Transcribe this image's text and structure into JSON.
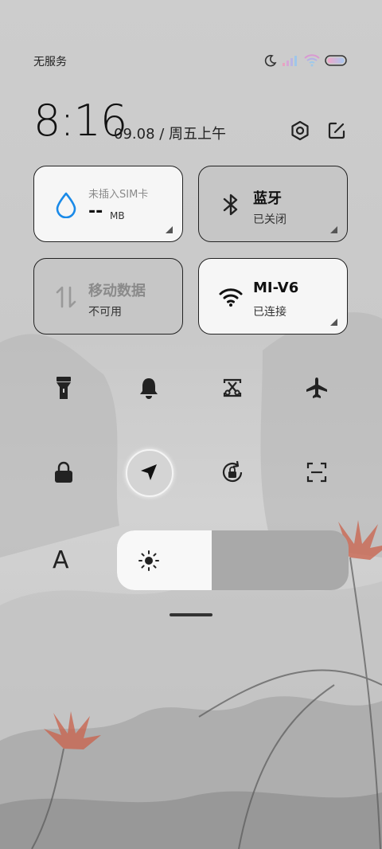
{
  "status_bar": {
    "carrier": "无服务",
    "icons": [
      "moon-icon",
      "signal-icon",
      "wifi-icon",
      "battery-icon"
    ]
  },
  "header": {
    "time": "8:16",
    "date": "09.08 / 周五上午",
    "icons": [
      "settings-icon",
      "edit-icon"
    ]
  },
  "tiles": {
    "data_usage": {
      "label": "未插入SIM卡",
      "value": "--",
      "unit": "MB",
      "icon": "water-drop-icon",
      "accent": "#1a8ae8"
    },
    "bluetooth": {
      "title": "蓝牙",
      "status": "已关闭",
      "icon": "bluetooth-icon"
    },
    "mobile_data": {
      "title": "移动数据",
      "status": "不可用",
      "icon": "mobile-data-icon"
    },
    "wifi": {
      "title": "MI-V6",
      "status": "已连接",
      "icon": "wifi-icon"
    }
  },
  "quick_toggles": [
    "flashlight-icon",
    "bell-icon",
    "screenshot-icon",
    "airplane-icon",
    "lock-icon",
    "location-icon",
    "rotation-lock-icon",
    "scanner-icon"
  ],
  "brightness": {
    "auto_label": "A",
    "level": 0.41,
    "icon": "sun-icon"
  }
}
